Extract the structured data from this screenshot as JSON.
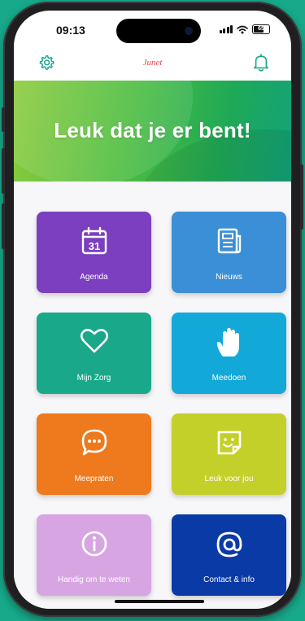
{
  "status_bar": {
    "time": "09:13",
    "battery": "65"
  },
  "header": {
    "app_name": "Junet"
  },
  "banner": {
    "title": "Leuk dat je er bent!"
  },
  "tiles": [
    {
      "label": "Agenda",
      "icon": "calendar-icon",
      "color": "#7c3fbf"
    },
    {
      "label": "Nieuws",
      "icon": "newspaper-icon",
      "color": "#3a8fd6"
    },
    {
      "label": "Mijn Zorg",
      "icon": "heart-icon",
      "color": "#19a98a"
    },
    {
      "label": "Meedoen",
      "icon": "hand-icon",
      "color": "#12a9d9"
    },
    {
      "label": "Meepraten",
      "icon": "chat-icon",
      "color": "#ee7a1d"
    },
    {
      "label": "Leuk voor jou",
      "icon": "smiley-note-icon",
      "color": "#c4d02a"
    },
    {
      "label": "Handig om te weten",
      "icon": "info-icon",
      "color": "#d7a6e2"
    },
    {
      "label": "Contact & info",
      "icon": "at-icon",
      "color": "#0a3aa6"
    }
  ],
  "calendar_day": "31",
  "colors": {
    "background": "#17a98a",
    "accent": "#19a98a",
    "logo": "#e5484d"
  }
}
